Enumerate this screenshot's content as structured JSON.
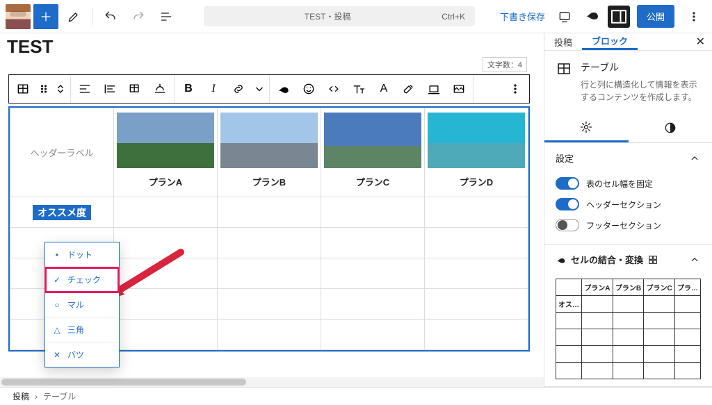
{
  "topbar": {
    "doc_title": "TEST・投稿",
    "shortcut": "Ctrl+K",
    "save_draft": "下書き保存",
    "publish": "公開"
  },
  "page": {
    "title": "TEST",
    "char_count": "文字数：4"
  },
  "table": {
    "header_label": "ヘッダーラベル",
    "plans": [
      "プランA",
      "プランB",
      "プランC",
      "プランD"
    ],
    "selected_cell_label": "オススメ度"
  },
  "popup": {
    "items": [
      {
        "icon": "•",
        "label": "ドット"
      },
      {
        "icon": "✓",
        "label": "チェック"
      },
      {
        "icon": "○",
        "label": "マル"
      },
      {
        "icon": "△",
        "label": "三角"
      },
      {
        "icon": "✕",
        "label": "バツ"
      }
    ],
    "highlight_index": 1
  },
  "sidebar": {
    "tabs": {
      "post": "投稿",
      "block": "ブロック"
    },
    "block_name": "テーブル",
    "block_desc": "行と列に構造化して情報を表示するコンテンツを作成します。",
    "settings_title": "設定",
    "toggles": {
      "fixed_width": "表のセル幅を固定",
      "header_section": "ヘッダーセクション",
      "footer_section": "フッターセクション"
    },
    "merge_title": "セルの結合・変換",
    "mini_table": {
      "headers": [
        "",
        "プランA",
        "プランB",
        "プランC",
        "プラ…"
      ],
      "row0": "オス…"
    }
  },
  "breadcrumb": {
    "root": "投稿",
    "current": "テーブル"
  }
}
